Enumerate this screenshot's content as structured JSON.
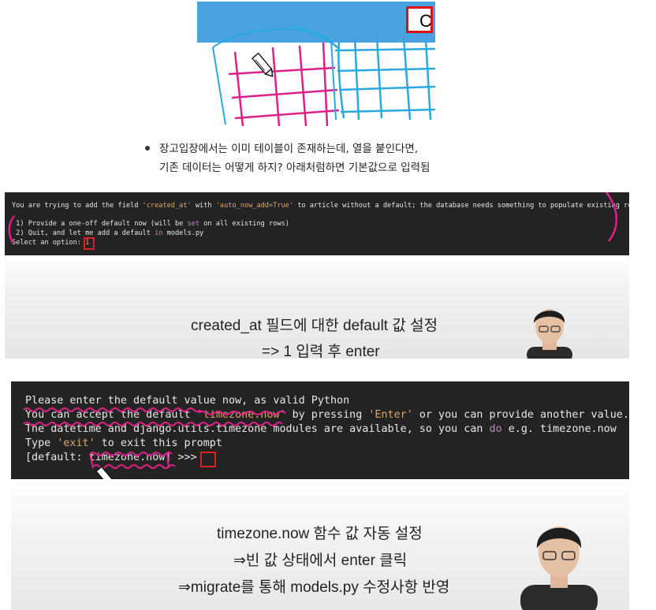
{
  "top_drawing": {
    "redbox_char": "C",
    "colors": {
      "sky": "#4aa3e0",
      "grid_magenta": "#e0208a",
      "grid_blue": "#2aa8e0",
      "highlight": "#d11111"
    }
  },
  "bullet": {
    "line1": "장고입장에서는 이미 테이블이 존재하는데, 열을 붙인다면,",
    "line2": "기존 데이터는 어떻게 하지? 아래처럼하면 기본값으로 입력됨"
  },
  "terminal1": {
    "line1_a": "You are trying to add the field ",
    "line1_b": "'created_at'",
    "line1_c": " with ",
    "line1_d": "'auto_now_add=True'",
    "line1_e": " to article without a default; the database needs something to populate existing rows.",
    "line2_a": " 1) Provide a one-off default now (will be ",
    "line2_b": "set",
    "line2_c": " on all existing rows)",
    "line3_a": " 2) Quit, and let me add a default ",
    "line3_b": "in",
    "line3_c": " models.py",
    "line4_a": "Select an option: ",
    "line4_b": "1"
  },
  "caption1": {
    "line1": "created_at 필드에 대한 default 값 설정",
    "line2": "=> 1 입력 후 enter"
  },
  "terminal2": {
    "line1": "Please enter the default value now, as valid Python",
    "line2_a": "You can accept the default ",
    "line2_b": "'timezone.now'",
    "line2_c": " by pressing ",
    "line2_d": "'Enter'",
    "line2_e": " or you can provide another value.",
    "line3_a": "The datetime and django.utils.timezone modules are available, so you can ",
    "line3_b": "do",
    "line3_c": " e.g. timezone.now",
    "line4_a": "Type ",
    "line4_b": "'exit'",
    "line4_c": " to exit this prompt",
    "line5": "[default: timezone.now] >>> "
  },
  "caption2": {
    "line1": "timezone.now 함수 값 자동 설정",
    "line2": "⇒빈 값 상태에서 enter 클릭",
    "line3": "⇒migrate를 통해 models.py 수정사항 반영"
  }
}
